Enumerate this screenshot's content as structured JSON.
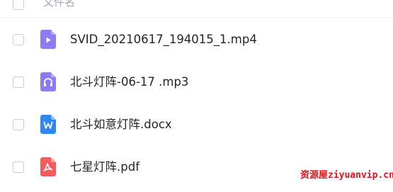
{
  "header": {
    "name_column_label": "文件名"
  },
  "files": [
    {
      "name": "SVID_20210617_194015_1.mp4",
      "type": "video",
      "icon": "video-file-icon",
      "color": "#8a7cf5"
    },
    {
      "name": "北斗灯阵-06-17 .mp3",
      "type": "audio",
      "icon": "audio-file-icon",
      "color": "#8a7cf5"
    },
    {
      "name": "北斗如意灯阵.docx",
      "type": "document",
      "icon": "word-file-icon",
      "color": "#2f86f6"
    },
    {
      "name": "七星灯阵.pdf",
      "type": "pdf",
      "icon": "pdf-file-icon",
      "color": "#f25c5c"
    }
  ],
  "watermark": {
    "text": "资源屋ziyuanvip.cn",
    "color": "#e4131b"
  }
}
